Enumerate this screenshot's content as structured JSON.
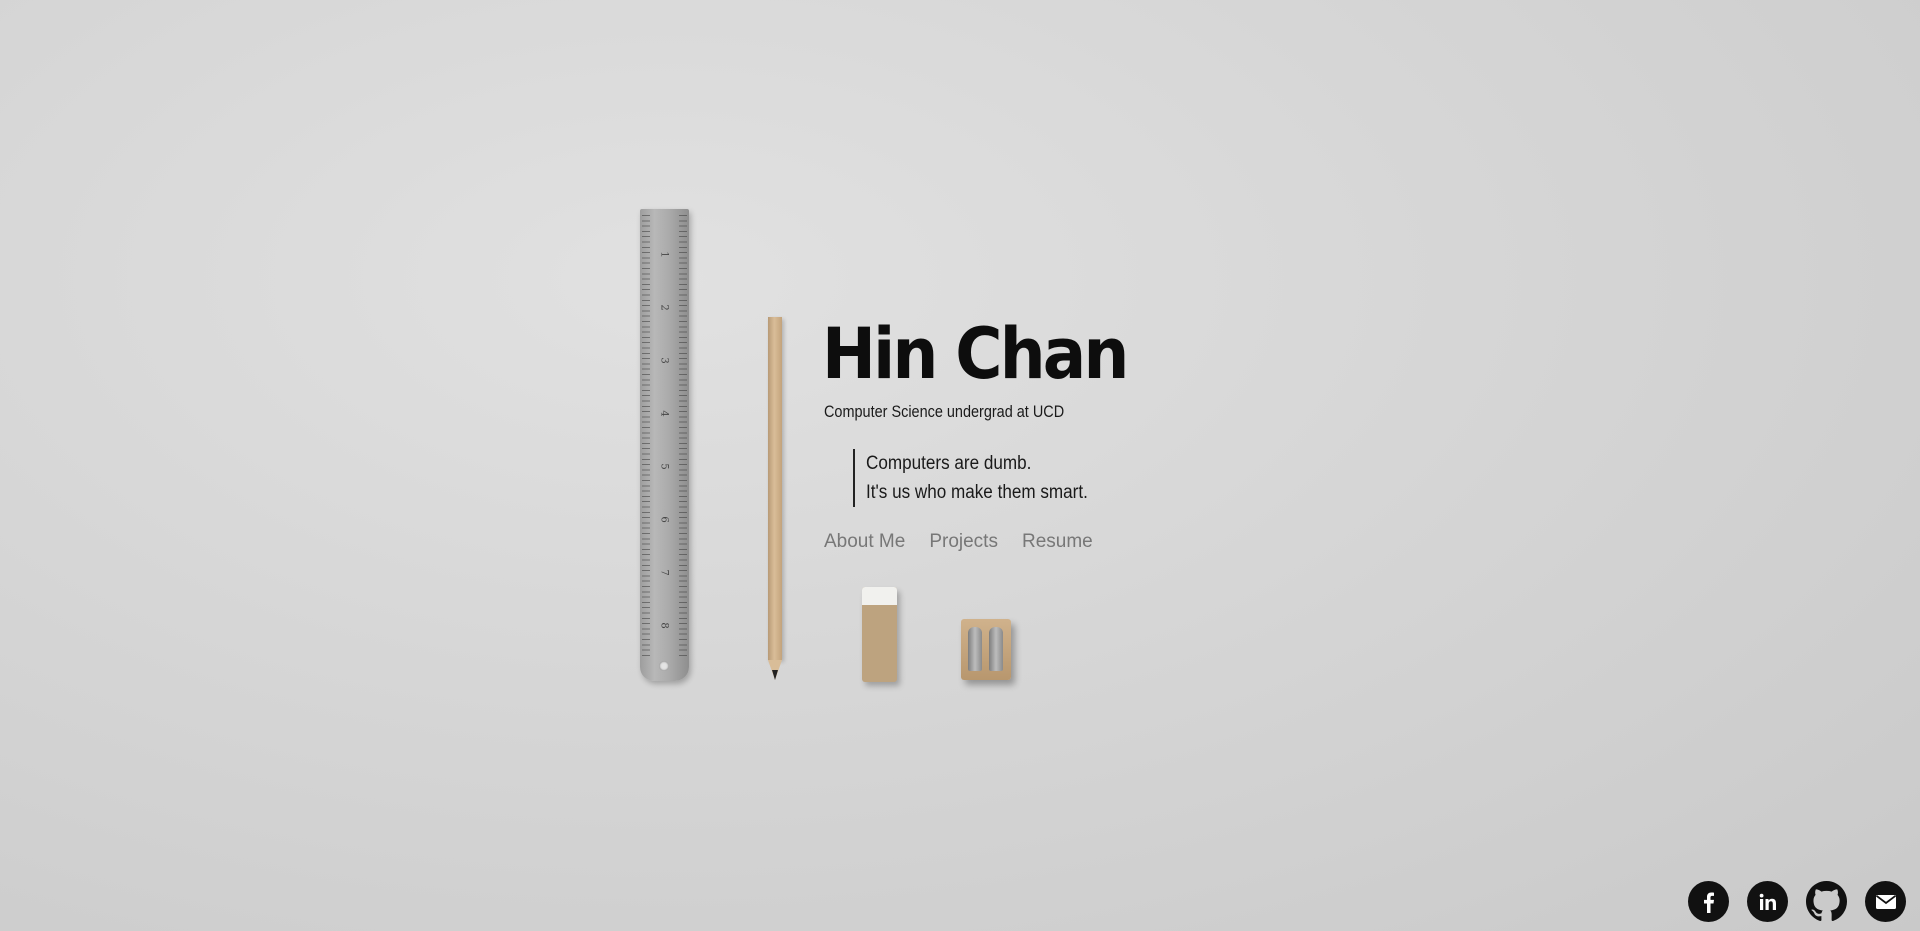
{
  "hero": {
    "name": "Hin Chan",
    "subtitle": "Computer Science undergrad at UCD",
    "quote_lines": [
      "Computers are dumb.",
      "It's us who make them smart."
    ]
  },
  "nav": {
    "items": [
      {
        "label": "About Me"
      },
      {
        "label": "Projects"
      },
      {
        "label": "Resume"
      }
    ]
  },
  "ruler": {
    "numbers": [
      "1",
      "2",
      "3",
      "4",
      "5",
      "6",
      "7",
      "8"
    ]
  },
  "social": {
    "items": [
      {
        "icon": "facebook-icon"
      },
      {
        "icon": "linkedin-icon"
      },
      {
        "icon": "github-icon"
      },
      {
        "icon": "email-icon"
      }
    ]
  }
}
